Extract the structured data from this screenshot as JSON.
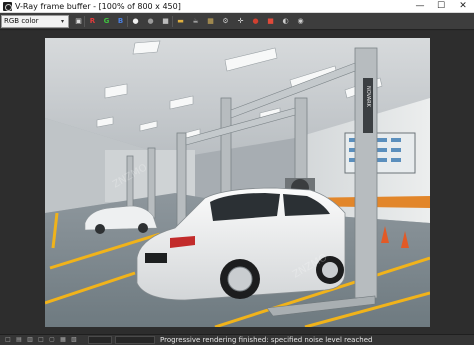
{
  "window": {
    "title": "V-Ray frame buffer - [100% of 800 x 450]",
    "minimize": "—",
    "maximize": "☐",
    "close": "✕"
  },
  "toolbar": {
    "channel_select": {
      "value": "RGB color",
      "arrow": "▾"
    },
    "buttons": [
      {
        "name": "save-icon",
        "glyph": "▣"
      },
      {
        "name": "red-channel-button",
        "glyph": "R",
        "color": "#e23b3b"
      },
      {
        "name": "green-channel-button",
        "glyph": "G",
        "color": "#3fbf3f"
      },
      {
        "name": "blue-channel-button",
        "glyph": "B",
        "color": "#4a7fe0"
      },
      {
        "name": "white-circle-icon",
        "glyph": "●",
        "color": "#f0f0f0"
      },
      {
        "name": "sphere-icon",
        "glyph": "●",
        "color": "#9a9a9a"
      },
      {
        "name": "clear-image-icon",
        "glyph": "■",
        "color": "#bbbbbb"
      },
      {
        "name": "folder-icon",
        "glyph": "▬",
        "color": "#e0b040"
      },
      {
        "name": "teapot-icon",
        "glyph": "☕",
        "color": "#cfcfcf"
      },
      {
        "name": "region-render-icon",
        "glyph": "▦",
        "color": "#d4b15a"
      },
      {
        "name": "link-icon",
        "glyph": "⚙",
        "color": "#c8c8c8"
      },
      {
        "name": "track-mouse-icon",
        "glyph": "✛",
        "color": "#d8d8d8"
      },
      {
        "name": "stop-render-icon",
        "glyph": "●",
        "color": "#d04030"
      },
      {
        "name": "render-icon",
        "glyph": "■",
        "color": "#e04a3a"
      },
      {
        "name": "history-icon",
        "glyph": "◐",
        "color": "#cccccc"
      },
      {
        "name": "settings-icon",
        "glyph": "◉",
        "color": "#cccccc"
      }
    ]
  },
  "statusbar": {
    "text": "Progressive rendering finished: specified noise level reached",
    "icons": [
      {
        "name": "status-icon-1",
        "glyph": "□"
      },
      {
        "name": "status-icon-2",
        "glyph": "▤"
      },
      {
        "name": "status-icon-3",
        "glyph": "▥"
      },
      {
        "name": "status-icon-4",
        "glyph": "□"
      },
      {
        "name": "status-icon-5",
        "glyph": "▢"
      },
      {
        "name": "status-icon-6",
        "glyph": "▦"
      },
      {
        "name": "status-icon-7",
        "glyph": "▧"
      }
    ],
    "colors": {
      "background": "#353535",
      "text": "#e6e6e6"
    }
  },
  "render_image": {
    "description_icons": [
      "car-icon",
      "lift-icon"
    ],
    "lift_brand": "NOVARK"
  },
  "colors": {
    "toolbar_bg": "#3d3d3d",
    "viewport_bg": "#2d2d2d",
    "title_bg": "#ffffff",
    "floor_stripe": "#f1b31a"
  }
}
